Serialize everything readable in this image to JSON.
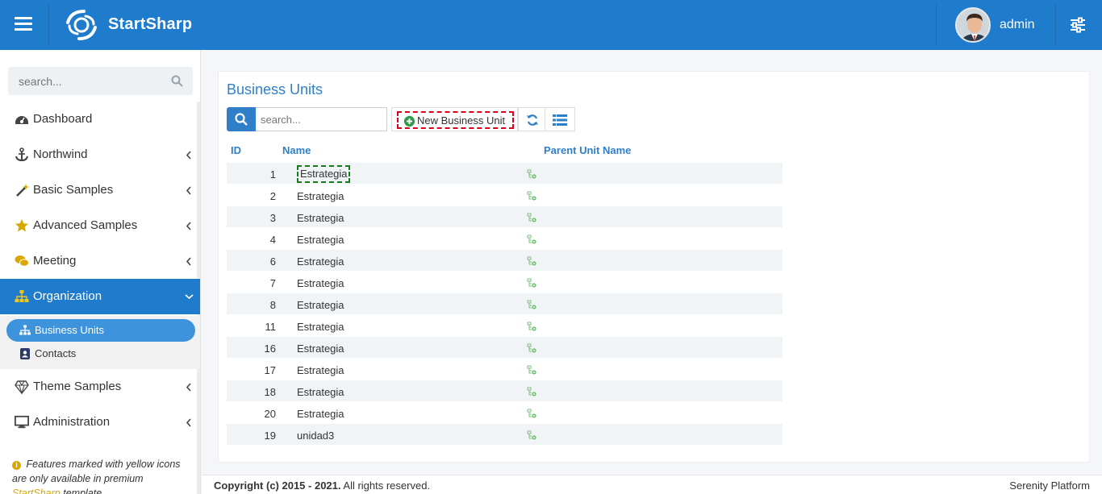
{
  "header": {
    "brand": "StartSharp",
    "username": "admin",
    "color": "#1f7bcc"
  },
  "sidebar": {
    "search_placeholder": "search...",
    "items": [
      {
        "label": "Dashboard",
        "icon": "dashboard-icon"
      },
      {
        "label": "Northwind",
        "icon": "anchor-icon"
      },
      {
        "label": "Basic Samples",
        "icon": "magic-wand-icon"
      },
      {
        "label": "Advanced Samples",
        "icon": "star-icon"
      },
      {
        "label": "Meeting",
        "icon": "comments-icon"
      },
      {
        "label": "Organization",
        "icon": "sitemap-icon",
        "active": true
      },
      {
        "label": "Theme Samples",
        "icon": "diamond-icon"
      },
      {
        "label": "Administration",
        "icon": "monitor-icon"
      }
    ],
    "sub_items": [
      {
        "label": "Business Units",
        "icon": "sitemap-icon",
        "active": true
      },
      {
        "label": "Contacts",
        "icon": "contact-card-icon"
      }
    ],
    "note": {
      "text_before": "Features marked with yellow icons are only available in premium",
      "brand": "StartSharp",
      "text_after": "template"
    }
  },
  "main": {
    "title": "Business Units",
    "search_placeholder": "search...",
    "new_button_label": "New Business Unit",
    "columns": [
      "ID",
      "Name",
      "Parent Unit Name"
    ],
    "rows": [
      {
        "id": "1",
        "name": "Estrategia"
      },
      {
        "id": "2",
        "name": "Estrategia"
      },
      {
        "id": "3",
        "name": "Estrategia"
      },
      {
        "id": "4",
        "name": "Estrategia"
      },
      {
        "id": "6",
        "name": "Estrategia"
      },
      {
        "id": "7",
        "name": "Estrategia"
      },
      {
        "id": "8",
        "name": "Estrategia"
      },
      {
        "id": "11",
        "name": "Estrategia"
      },
      {
        "id": "16",
        "name": "Estrategia"
      },
      {
        "id": "17",
        "name": "Estrategia"
      },
      {
        "id": "18",
        "name": "Estrategia"
      },
      {
        "id": "20",
        "name": "Estrategia"
      },
      {
        "id": "19",
        "name": "unidad3"
      }
    ]
  },
  "footer": {
    "copyright_bold": "Copyright (c) 2015 - 2021.",
    "copyright_rest": " All rights reserved.",
    "platform": "Serenity Platform"
  }
}
